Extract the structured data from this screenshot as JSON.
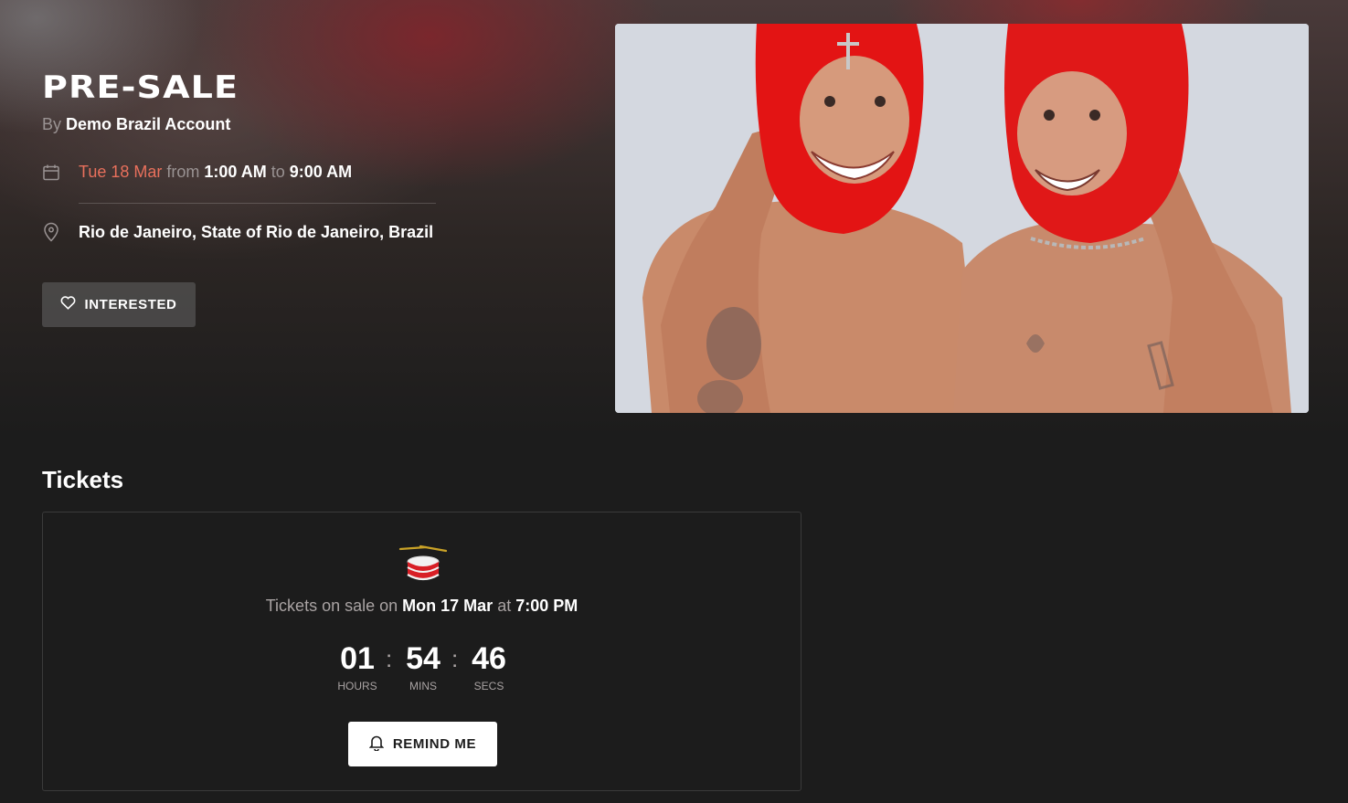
{
  "event": {
    "title": "PRE-SALE",
    "by_prefix": "By",
    "organizer": "Demo Brazil Account",
    "date": "Tue 18 Mar",
    "from_word": "from",
    "start_time": "1:00 AM",
    "to_word": "to",
    "end_time": "9:00 AM",
    "location": "Rio de Janeiro, State of Rio de Janeiro, Brazil",
    "interested_label": "INTERESTED"
  },
  "icons": {
    "calendar": "calendar-icon",
    "location": "map-pin-icon",
    "interested": "heart-icon",
    "drum": "drum-icon",
    "remind": "bell-icon"
  },
  "tickets": {
    "heading": "Tickets",
    "sale_prefix": "Tickets on sale on",
    "sale_date": "Mon 17 Mar",
    "sale_at": "at",
    "sale_time": "7:00 PM",
    "countdown": {
      "hours": "01",
      "minutes": "54",
      "seconds": "46",
      "separator": ":",
      "hours_label": "HOURS",
      "minutes_label": "MINS",
      "seconds_label": "SECS"
    },
    "remind_label": "REMIND ME"
  },
  "colors": {
    "background": "#1c1c1c",
    "date_accent": "#e8705c",
    "muted_text": "#9a9393",
    "button_secondary": "#5a5a5a",
    "button_primary": "#ffffff"
  }
}
